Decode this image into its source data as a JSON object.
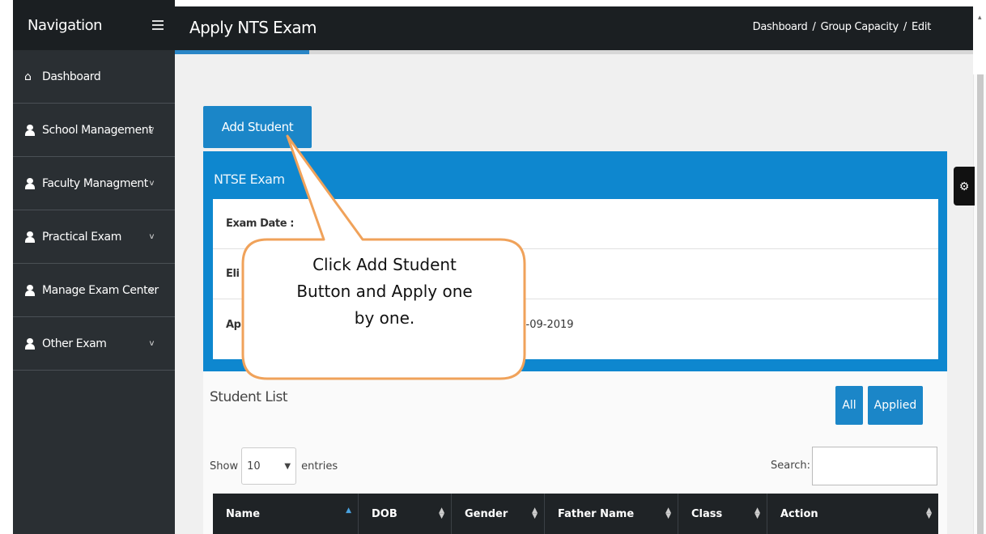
{
  "sidebar": {
    "title": "Navigation",
    "items": [
      {
        "label": "Dashboard",
        "icon": "home-icon"
      },
      {
        "label": "School Management",
        "icon": "user-icon"
      },
      {
        "label": "Faculty Managment",
        "icon": "user-icon"
      },
      {
        "label": "Practical Exam",
        "icon": "user-icon"
      },
      {
        "label": "Manage Exam Center",
        "icon": "user-icon"
      },
      {
        "label": "Other Exam",
        "icon": "user-icon"
      }
    ],
    "chevron": "v"
  },
  "header": {
    "title": "Apply NTS Exam",
    "breadcrumb": [
      "Dashboard",
      "Group Capacity",
      "Edit"
    ],
    "separator": "/"
  },
  "main": {
    "add_button": "Add Student",
    "exam_panel": {
      "title": "NTSE Exam",
      "rows": [
        {
          "label": "Exam Date :",
          "value": ""
        },
        {
          "label": "Eli",
          "value": ""
        },
        {
          "label": "Ap",
          "value": "18-09-2019"
        }
      ]
    },
    "student_list": {
      "title": "Student List",
      "filters": [
        "All",
        "Applied"
      ],
      "show_label": "Show",
      "show_value": "10",
      "entries_label": "entries",
      "search_label": "Search:",
      "columns": [
        "Name",
        "DOB",
        "Gender",
        "Father Name",
        "Class",
        "Action"
      ]
    }
  },
  "callout": {
    "lines": [
      "Click Add Student",
      "Button and Apply one",
      "by one."
    ]
  },
  "colors": {
    "accent": "#1b86c8",
    "sidebar": "#2a2f33",
    "header": "#1b1f22",
    "callout_border": "#f0a25a"
  }
}
